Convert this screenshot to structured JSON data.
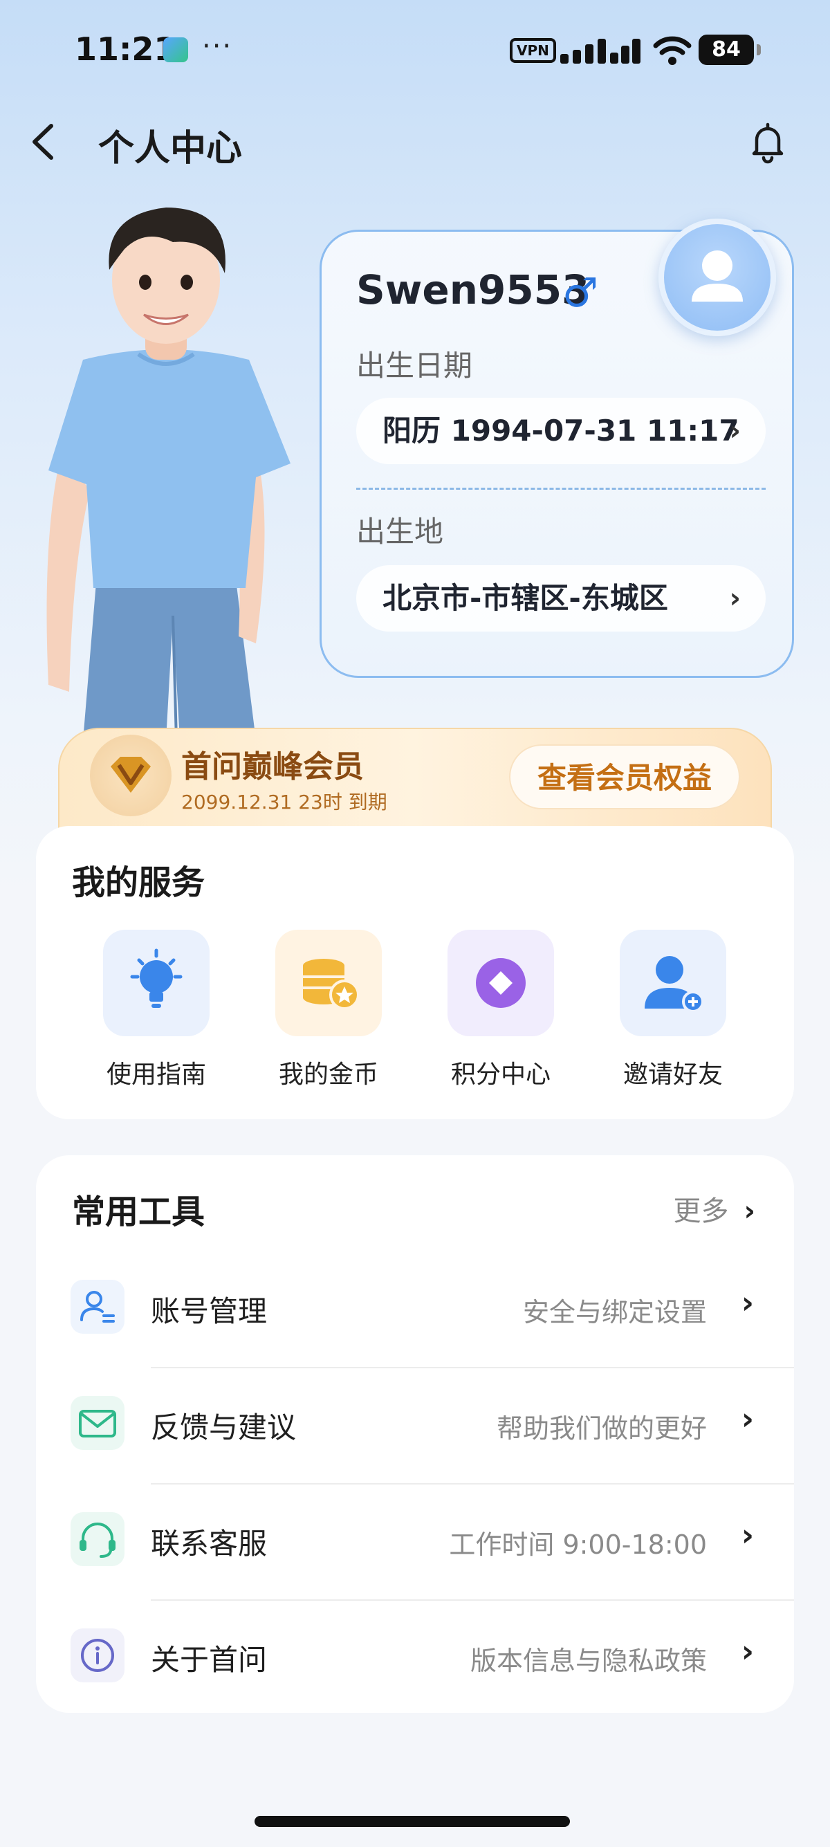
{
  "status_bar": {
    "time": "11:21",
    "more": "···",
    "vpn": "VPN",
    "battery": "84"
  },
  "header": {
    "title": "个人中心"
  },
  "profile": {
    "username": "Swen9553",
    "gender_symbol": "♂",
    "birth_label": "出生日期",
    "birth_value": "阳历 1994-07-31 11:17",
    "birthplace_label": "出生地",
    "birthplace_value": "北京市-市辖区-东城区"
  },
  "membership": {
    "title": "首问巅峰会员",
    "expiry": "2099.12.31 23时 到期",
    "button": "查看会员权益"
  },
  "services": {
    "title": "我的服务",
    "items": [
      {
        "label": "使用指南",
        "icon": "lightbulb-icon"
      },
      {
        "label": "我的金币",
        "icon": "coins-icon"
      },
      {
        "label": "积分中心",
        "icon": "points-icon"
      },
      {
        "label": "邀请好友",
        "icon": "add-user-icon"
      }
    ]
  },
  "tools": {
    "title": "常用工具",
    "more": "更多",
    "items": [
      {
        "label": "账号管理",
        "desc": "安全与绑定设置",
        "icon": "account-icon"
      },
      {
        "label": "反馈与建议",
        "desc": "帮助我们做的更好",
        "icon": "mail-icon"
      },
      {
        "label": "联系客服",
        "desc": "工作时间 9:00-18:00",
        "icon": "headset-icon"
      },
      {
        "label": "关于首问",
        "desc": "版本信息与隐私政策",
        "icon": "info-icon"
      }
    ]
  },
  "colors": {
    "accent_blue": "#2a76e0",
    "member_gold": "#c46f14"
  }
}
